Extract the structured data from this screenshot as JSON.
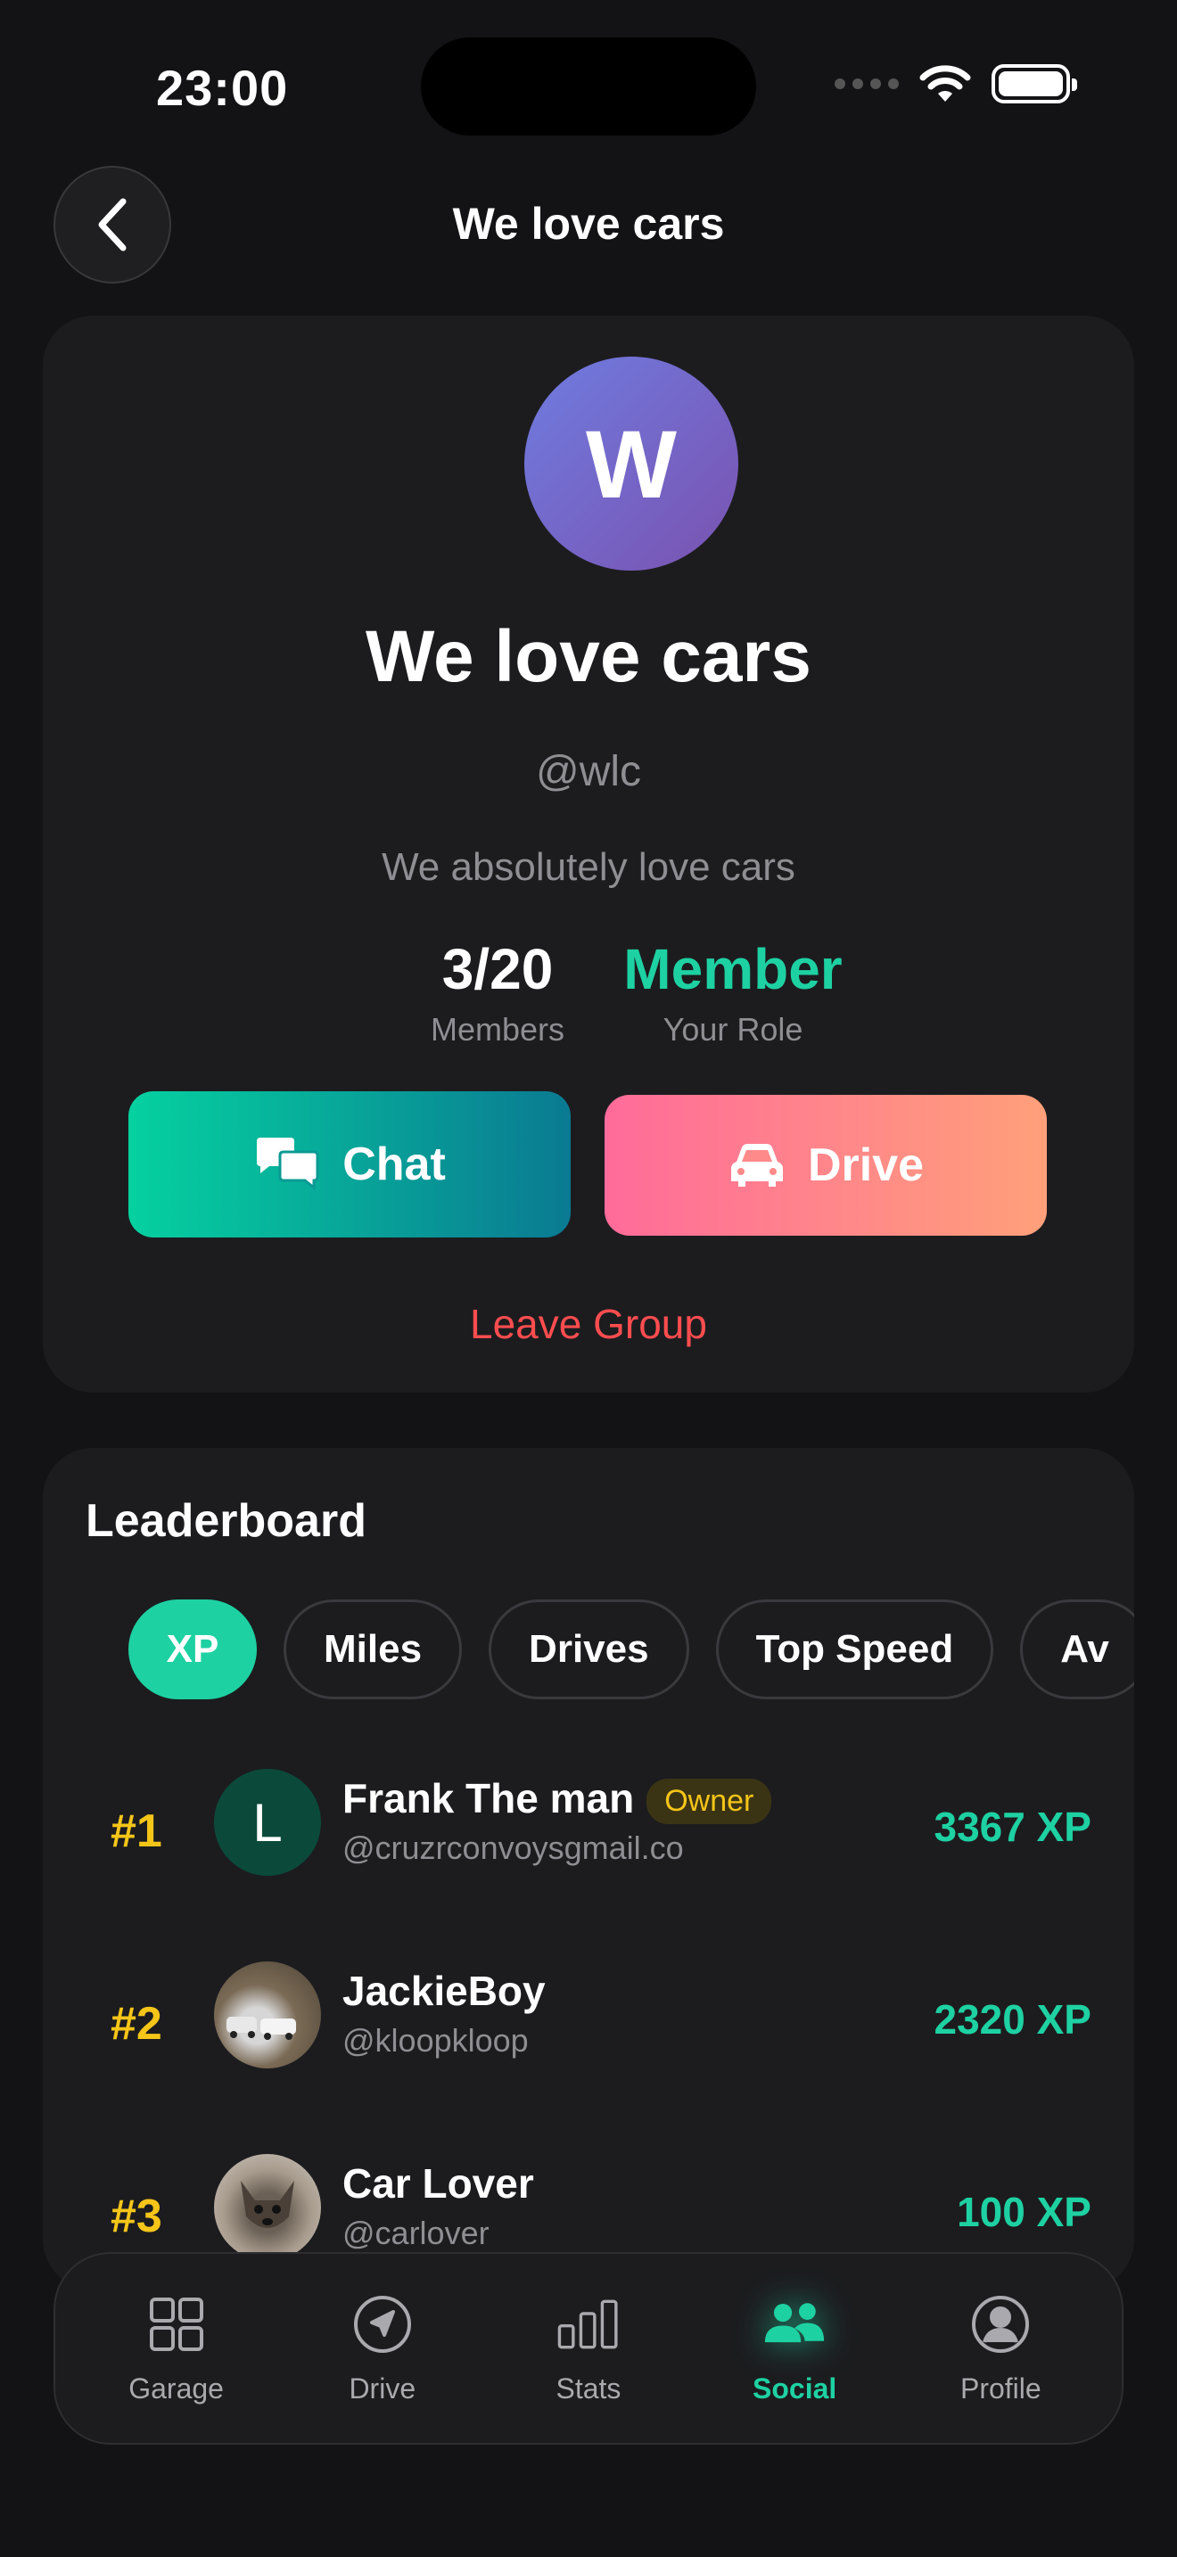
{
  "status_bar": {
    "time": "23:00"
  },
  "header": {
    "title": "We love cars"
  },
  "group": {
    "avatar_letter": "W",
    "name": "We love cars",
    "handle": "@wlc",
    "description": "We absolutely love cars",
    "members_value": "3/20",
    "members_label": "Members",
    "role_value": "Member",
    "role_label": "Your Role",
    "chat_label": "Chat",
    "drive_label": "Drive",
    "leave_label": "Leave Group"
  },
  "leaderboard": {
    "title": "Leaderboard",
    "tabs": [
      "XP",
      "Miles",
      "Drives",
      "Top Speed",
      "Av"
    ],
    "active_tab": "XP",
    "rows": [
      {
        "rank": "#1",
        "avatar_letter": "L",
        "name": "Frank The man",
        "badge": "Owner",
        "handle": "@cruzrconvoysgmail.co",
        "score": "3367 XP"
      },
      {
        "rank": "#2",
        "avatar_letter": "",
        "name": "JackieBoy",
        "badge": "",
        "handle": "@kloopkloop",
        "score": "2320 XP"
      },
      {
        "rank": "#3",
        "avatar_letter": "",
        "name": "Car Lover",
        "badge": "",
        "handle": "@carlover",
        "score": "100 XP"
      }
    ]
  },
  "tabbar": {
    "items": [
      {
        "label": "Garage",
        "icon": "grid-icon"
      },
      {
        "label": "Drive",
        "icon": "navigation-icon"
      },
      {
        "label": "Stats",
        "icon": "bar-chart-icon"
      },
      {
        "label": "Social",
        "icon": "people-icon"
      },
      {
        "label": "Profile",
        "icon": "person-circle-icon"
      }
    ],
    "active": "Social"
  },
  "colors": {
    "accent": "#1ed1a2",
    "rank": "#f5c518",
    "danger": "#ff4d4f",
    "background": "#131315",
    "card": "#1c1c1f"
  }
}
